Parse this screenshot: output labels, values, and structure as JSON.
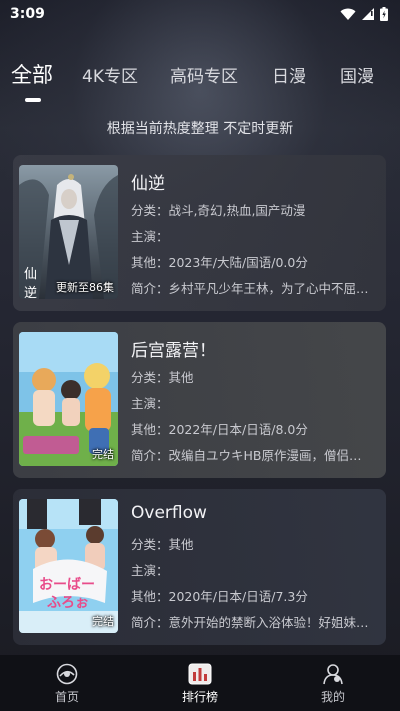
{
  "status_bar": {
    "time": "3:09"
  },
  "tabs": [
    {
      "label": "全部",
      "active": true
    },
    {
      "label": "4K专区",
      "active": false
    },
    {
      "label": "高码专区",
      "active": false
    },
    {
      "label": "日漫",
      "active": false
    },
    {
      "label": "国漫",
      "active": false
    }
  ],
  "subtitle": "根据当前热度整理 不定时更新",
  "items": [
    {
      "title": "仙逆",
      "badge": "更新至86集",
      "category": "分类：战斗,奇幻,热血,国产动漫",
      "cast": "主演：",
      "other": "其他：2023年/大陆/国语/0.0分",
      "intro": "简介：乡村平凡少年王林，为了心中不屈…"
    },
    {
      "title": "后宫露营！",
      "badge": "完结",
      "category": "分类：其他",
      "cast": "主演：",
      "other": "其他：2022年/日本/日语/8.0分",
      "intro": "简介：改编自ユウキHB原作漫画，僧侣…"
    },
    {
      "title": "Overflow",
      "badge": "完结",
      "category": "分类：其他",
      "cast": "主演：",
      "other": "其他：2020年/日本/日语/7.3分",
      "intro": "简介：意外开始的禁断入浴体验！好姐妹…"
    }
  ],
  "nav": [
    {
      "label": "首页",
      "icon": "home-icon",
      "active": false
    },
    {
      "label": "排行榜",
      "icon": "ranking-icon",
      "active": true
    },
    {
      "label": "我的",
      "icon": "profile-icon",
      "active": false
    }
  ]
}
